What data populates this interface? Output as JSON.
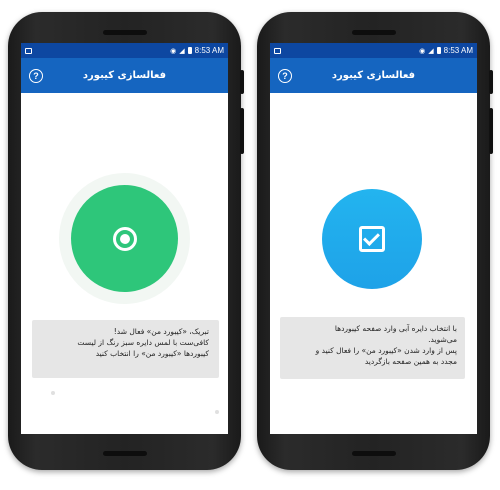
{
  "left_phone": {
    "status": {
      "time": "8:53 AM"
    },
    "appbar": {
      "title": "فعالسازی کیبورد",
      "help_icon": "?"
    },
    "icon": "radio-selected-icon",
    "message": {
      "line1": "تبریک، «کیبورد من» فعال شد!",
      "line2": "کافی‌ست با لمس دایره سبز رنگ از لیست",
      "line3": "کیبوردها «کیبورد من» را انتخاب کنید"
    },
    "accent": "#2ec67a"
  },
  "right_phone": {
    "status": {
      "time": "8:53 AM"
    },
    "appbar": {
      "title": "فعالسازی کیبورد",
      "help_icon": "?"
    },
    "icon": "checkbox-checked-icon",
    "message": {
      "line1": "با انتخاب دایره آبی وارد صفحه کیبوردها",
      "line2": "می‌شوید.",
      "line3": "پس از وارد شدن «کیبورد من» را فعال کنید و",
      "line4": "مجدد به همین صفحه بازگردید"
    },
    "accent": "#1ea2e8"
  },
  "colors": {
    "statusbar": "#0d47a1",
    "appbar": "#1565c0",
    "message_bg": "#e6e6e6"
  }
}
